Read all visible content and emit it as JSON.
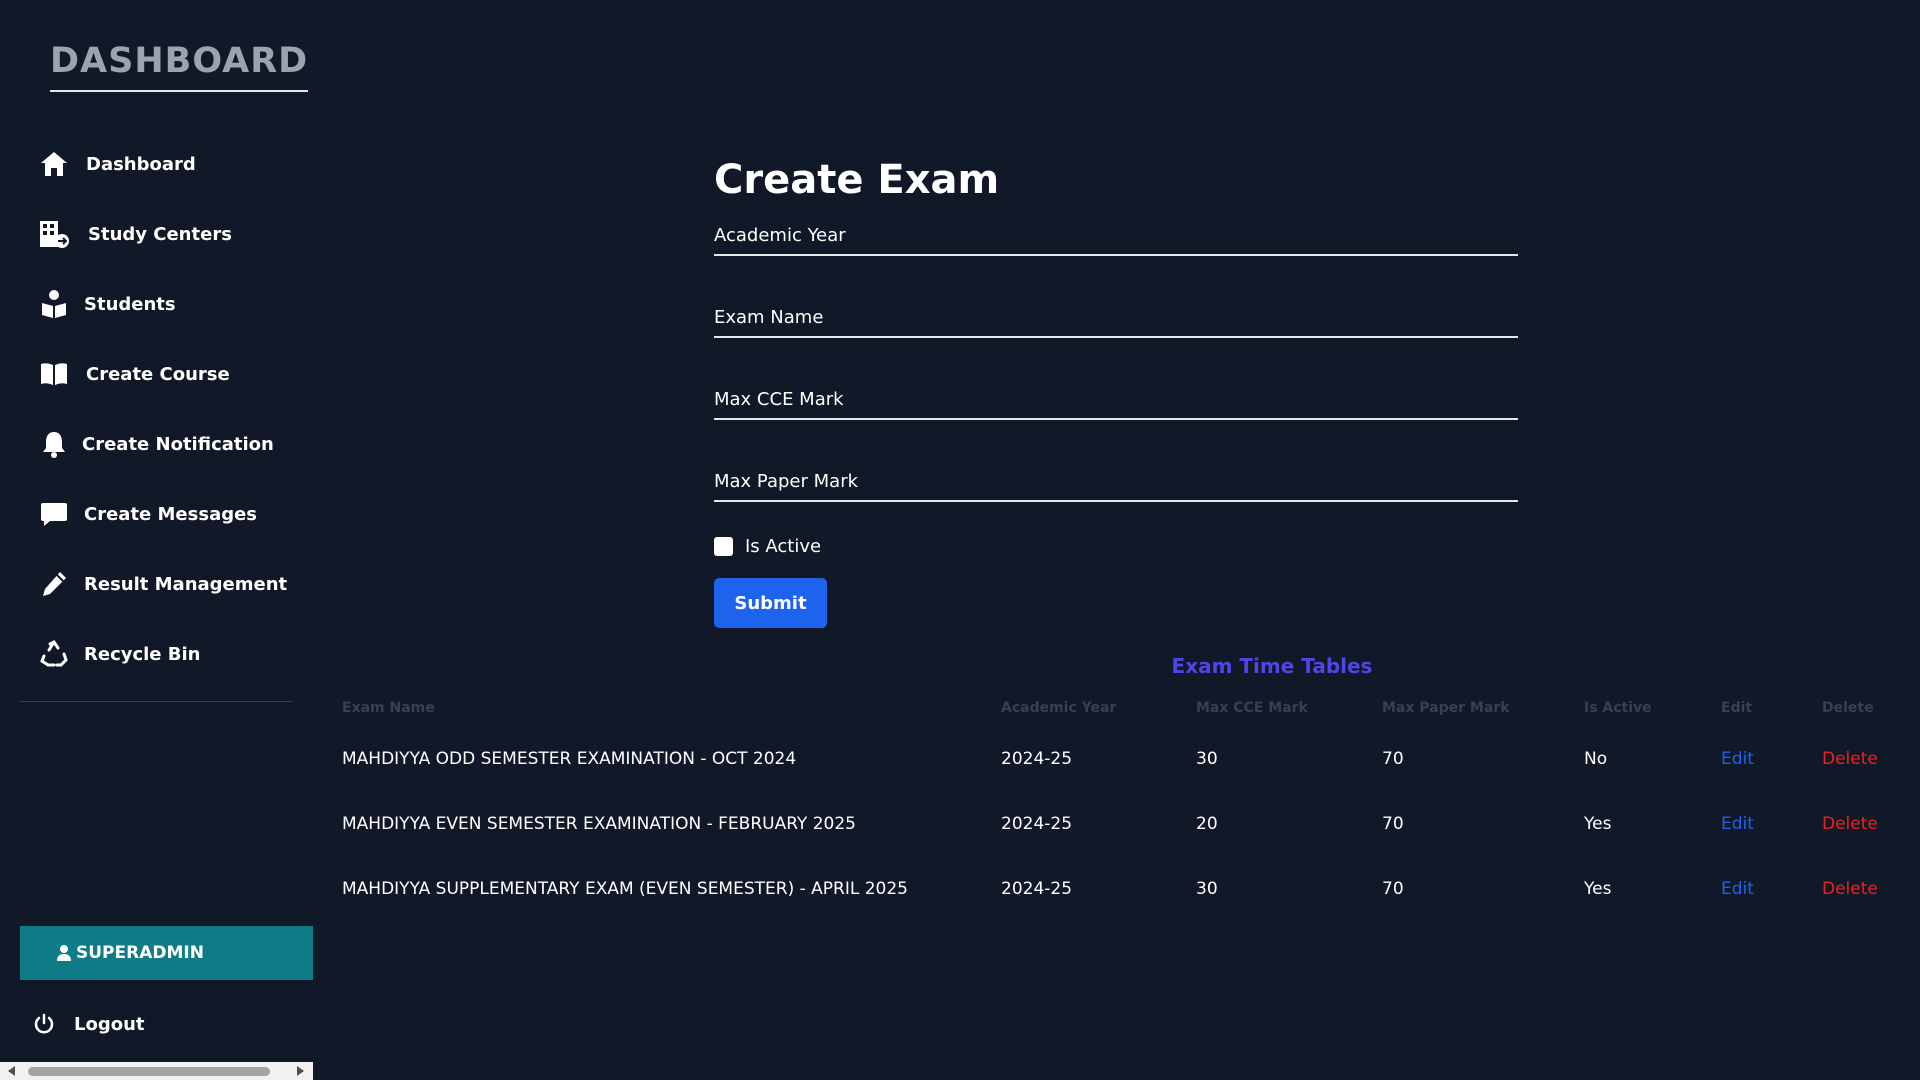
{
  "sidebar": {
    "brand": "DASHBOARD",
    "items": [
      {
        "label": "Dashboard",
        "icon": "home-icon"
      },
      {
        "label": "Study Centers",
        "icon": "building-icon"
      },
      {
        "label": "Students",
        "icon": "student-icon"
      },
      {
        "label": "Create Course",
        "icon": "book-icon"
      },
      {
        "label": "Create Notification",
        "icon": "bell-icon"
      },
      {
        "label": "Create Messages",
        "icon": "message-icon"
      },
      {
        "label": "Result Management",
        "icon": "pen-icon"
      },
      {
        "label": "Recycle Bin",
        "icon": "recycle-icon"
      }
    ],
    "user": "SUPERADMIN",
    "logout": "Logout"
  },
  "form": {
    "title": "Create Exam",
    "academic_year_placeholder": "Academic Year",
    "exam_name_placeholder": "Exam Name",
    "max_cce_placeholder": "Max CCE Mark",
    "max_paper_placeholder": "Max Paper Mark",
    "is_active_label": "Is Active",
    "submit_label": "Submit"
  },
  "table": {
    "title": "Exam Time Tables",
    "headers": [
      "Exam Name",
      "Academic Year",
      "Max CCE Mark",
      "Max Paper Mark",
      "Is Active",
      "Edit",
      "Delete"
    ],
    "rows": [
      {
        "name": "MAHDIYYA ODD SEMESTER EXAMINATION - OCT 2024",
        "year": "2024-25",
        "cce": "30",
        "paper": "70",
        "active": "No",
        "edit": "Edit",
        "delete": "Delete"
      },
      {
        "name": "MAHDIYYA EVEN SEMESTER EXAMINATION - FEBRUARY 2025",
        "year": "2024-25",
        "cce": "20",
        "paper": "70",
        "active": "Yes",
        "edit": "Edit",
        "delete": "Delete"
      },
      {
        "name": "MAHDIYYA SUPPLEMENTARY EXAM (EVEN SEMESTER) - APRIL 2025",
        "year": "2024-25",
        "cce": "30",
        "paper": "70",
        "active": "Yes",
        "edit": "Edit",
        "delete": "Delete"
      }
    ]
  },
  "colors": {
    "background": "#111827",
    "accent": "#1d63ed",
    "table_title": "#4f46e5",
    "user_box": "#0e7c86",
    "delete": "#ef2020"
  }
}
